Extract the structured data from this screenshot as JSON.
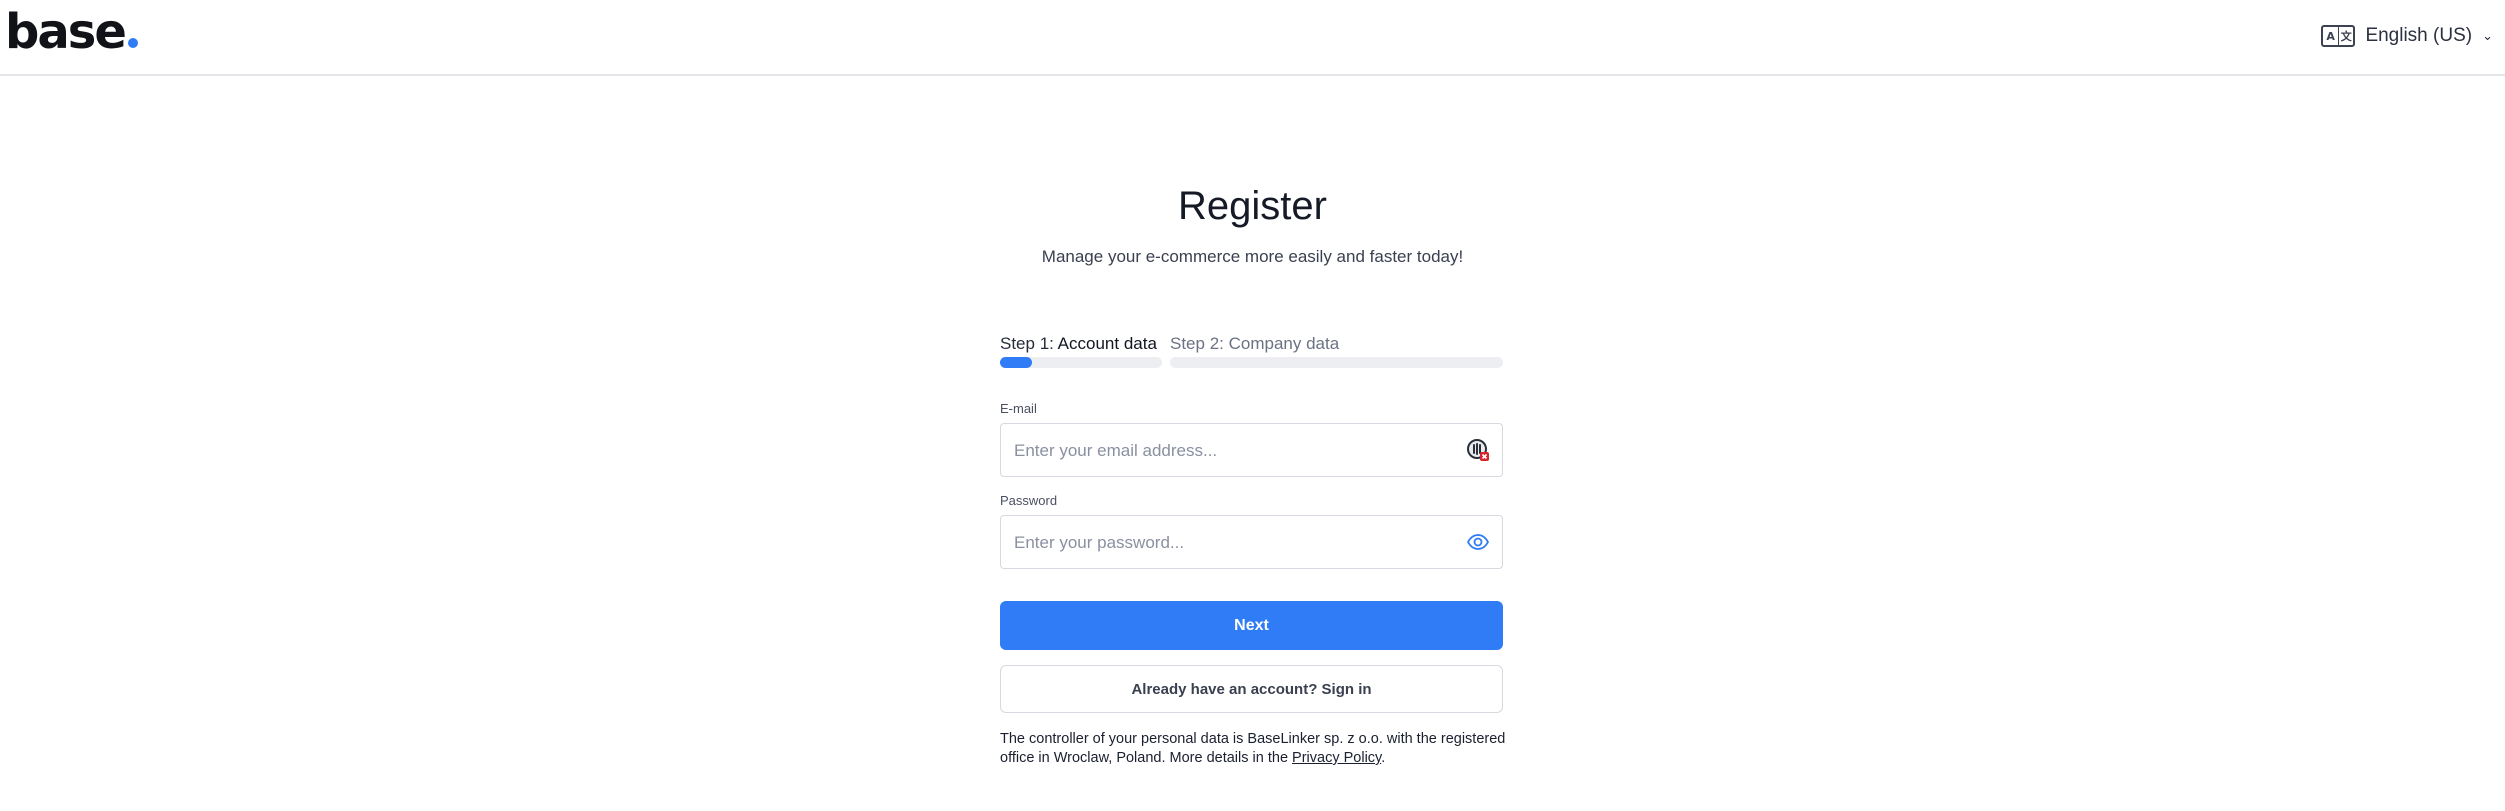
{
  "header": {
    "logo_text": "base",
    "language_label": "English (US)",
    "language_icon": "translate-icon",
    "accent_color": "#2f7cf6"
  },
  "main": {
    "title": "Register",
    "subtitle": "Manage your e-commerce more easily and faster today!",
    "steps": [
      {
        "prefix": "Step 1:",
        "label": "Account data",
        "active": true,
        "progress": 0.2
      },
      {
        "prefix": "Step 2:",
        "label": "Company data",
        "active": false,
        "progress": 0
      }
    ],
    "email": {
      "label": "E-mail",
      "placeholder": "Enter your email address...",
      "value": "",
      "icon": "password-manager-icon"
    },
    "password": {
      "label": "Password",
      "placeholder": "Enter your password...",
      "value": "",
      "icon": "eye-icon"
    },
    "next_button": "Next",
    "signin_button": "Already have an account? Sign in",
    "notice": {
      "text_before": "The controller of your personal data is BaseLinker sp. z o.o. with the registered office in Wroclaw, Poland. More details in the ",
      "link": "Privacy Policy",
      "text_after": "."
    }
  }
}
